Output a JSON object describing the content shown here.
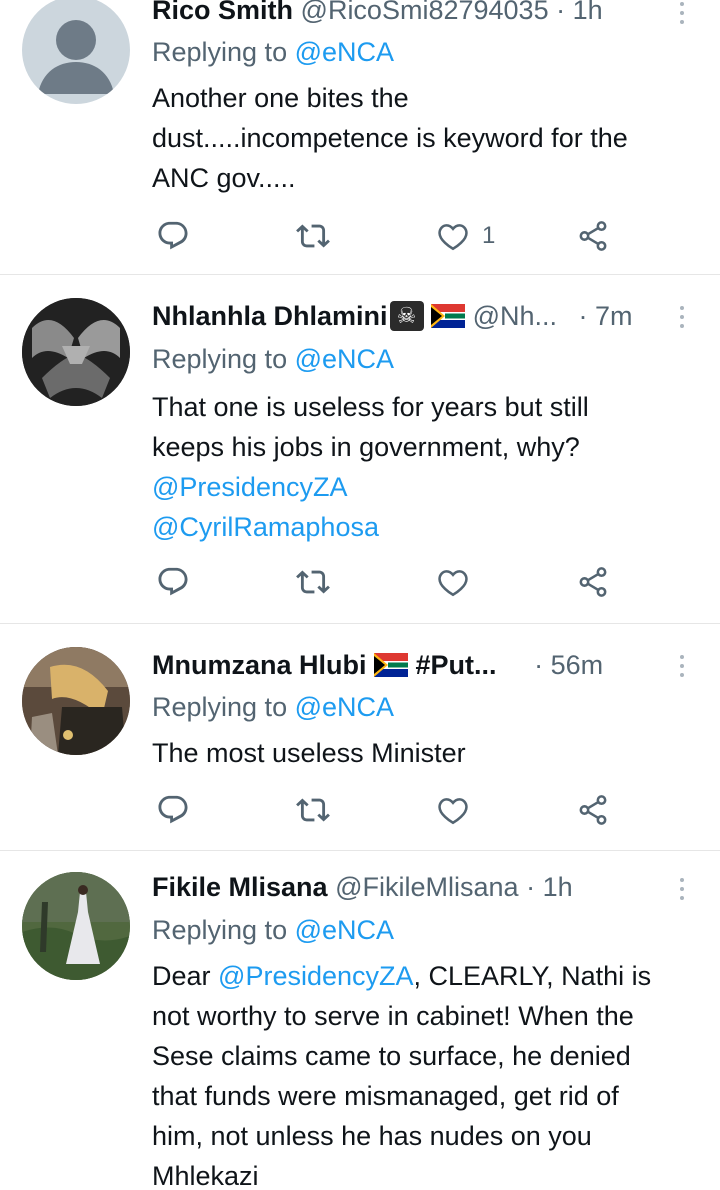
{
  "tweets": [
    {
      "name": "Rico Smith",
      "handle": "@RicoSmi82794035",
      "time": "1h",
      "reply_prefix": "Replying to ",
      "reply_to": "@eNCA",
      "text_lines": [
        "Another one bites the",
        "dust.....incompetence is keyword for the",
        "ANC gov....."
      ],
      "likes": "1",
      "avatar": "default"
    },
    {
      "name": "Nhlanhla Dhlamini",
      "name_emoji": "☠",
      "handle": "@Nh...",
      "time": "7m",
      "reply_prefix": "Replying to ",
      "reply_to": "@eNCA",
      "text_lines": [
        "That one is useless for years but still",
        "keeps his jobs in government, why?"
      ],
      "mentions": [
        "@PresidencyZA",
        "@CyrilRamaphosa"
      ],
      "likes": "",
      "avatar": "photo-hands"
    },
    {
      "name": "Mnumzana Hlubi",
      "name_suffix": "#Put...",
      "time": "56m",
      "reply_prefix": "Replying to ",
      "reply_to": "@eNCA",
      "text_lines": [
        "The most useless Minister"
      ],
      "likes": "",
      "avatar": "photo-car"
    },
    {
      "name": "Fikile Mlisana",
      "handle": "@FikileMlisana",
      "time": "1h",
      "reply_prefix": "Replying to ",
      "reply_to": "@eNCA",
      "text_first_prefix": "Dear ",
      "text_first_mention": "@PresidencyZA",
      "text_first_suffix": ", CLEARLY, Nathi is",
      "text_lines": [
        "not worthy to serve in cabinet! When the",
        "Sese claims came to surface, he denied",
        "that funds were mismanaged, get rid of",
        "him, not unless he has nudes on you",
        "Mhlekazi"
      ],
      "avatar": "photo-dress"
    }
  ],
  "separator": "·",
  "icons": [
    "reply-icon",
    "retweet-icon",
    "like-icon",
    "share-icon",
    "more-icon"
  ],
  "colors": {
    "link": "#1d9bf0",
    "muted": "#536471",
    "text": "#0f1419"
  }
}
